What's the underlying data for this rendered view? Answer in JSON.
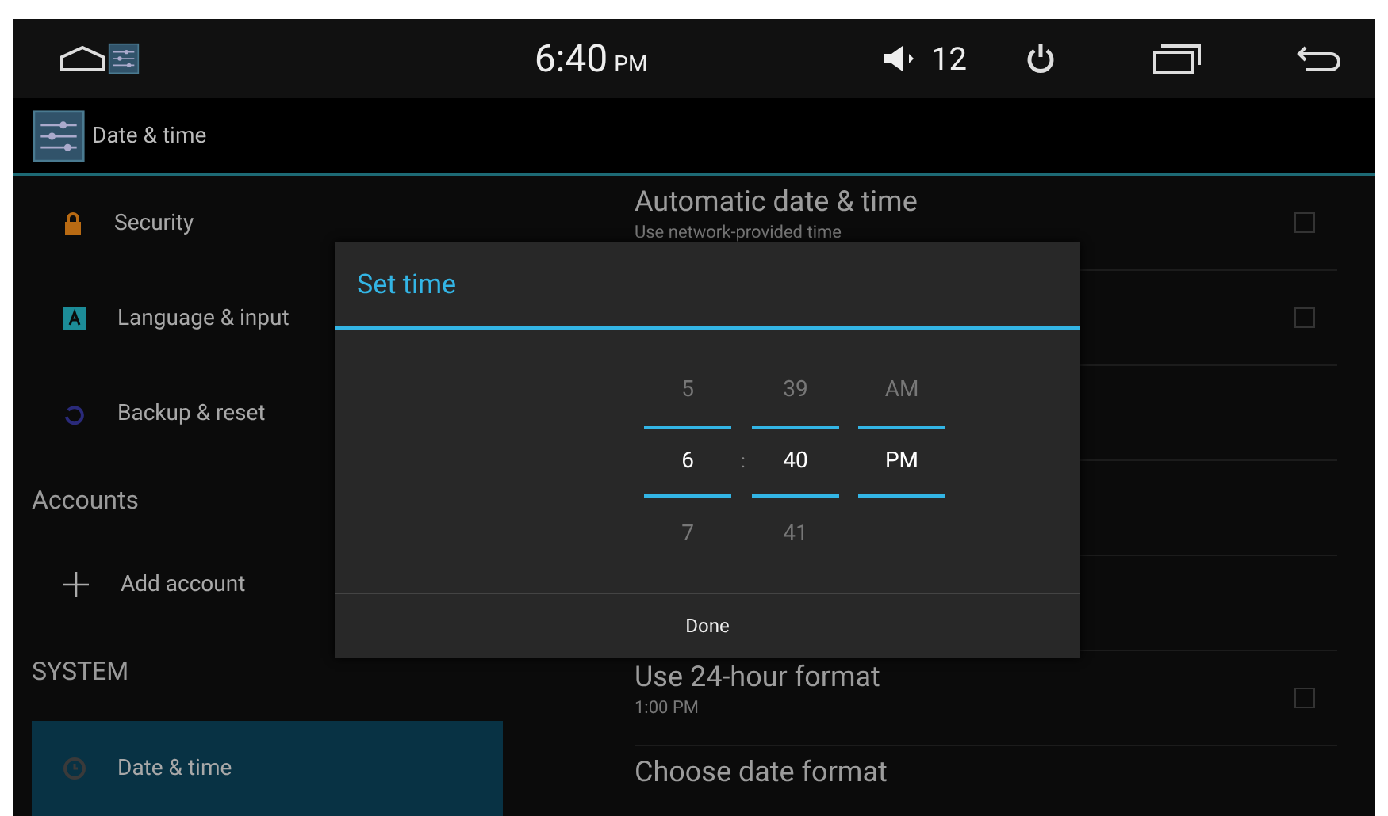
{
  "status_bar": {
    "time": "6:40",
    "ampm": "PM",
    "volume": "12"
  },
  "action_bar": {
    "title": "Date & time"
  },
  "sidebar": {
    "items": [
      {
        "kind": "item",
        "label": "Security",
        "selected": false
      },
      {
        "kind": "item",
        "label": "Language & input",
        "selected": false
      },
      {
        "kind": "item",
        "label": "Backup & reset",
        "selected": false
      },
      {
        "kind": "header",
        "label": "Accounts"
      },
      {
        "kind": "item",
        "label": "Add account",
        "selected": false
      },
      {
        "kind": "header",
        "label": "SYSTEM"
      },
      {
        "kind": "item",
        "label": "Date & time",
        "selected": true
      }
    ]
  },
  "settings": [
    {
      "kind": "checkbox",
      "title": "Automatic date & time",
      "subtitle": "Use network-provided time",
      "checked": false
    },
    {
      "kind": "checkbox",
      "checked": false
    },
    {
      "kind": "plain"
    },
    {
      "kind": "plain"
    },
    {
      "kind": "plain"
    },
    {
      "kind": "checkbox",
      "title": "Use 24-hour format",
      "subtitle": "1:00 PM",
      "checked": false
    },
    {
      "kind": "plain",
      "title": "Choose date format"
    }
  ],
  "dialog": {
    "title": "Set time",
    "separator": ":",
    "columns": [
      {
        "prev": "5",
        "current": "6",
        "next": "7"
      },
      {
        "prev": "39",
        "current": "40",
        "next": "41"
      },
      {
        "prev": "AM",
        "current": "PM"
      }
    ],
    "button": "Done"
  }
}
